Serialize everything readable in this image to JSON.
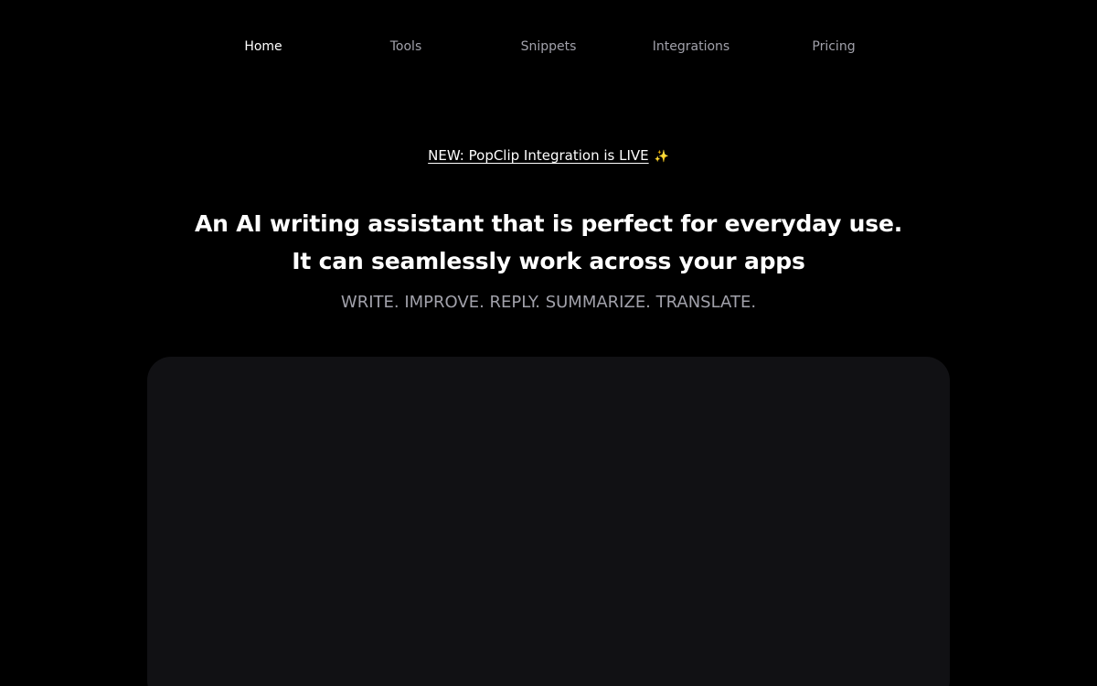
{
  "nav": {
    "items": [
      {
        "label": "Home",
        "active": true
      },
      {
        "label": "Tools",
        "active": false
      },
      {
        "label": "Snippets",
        "active": false
      },
      {
        "label": "Integrations",
        "active": false
      },
      {
        "label": "Pricing",
        "active": false
      }
    ]
  },
  "announcement": {
    "text": "NEW: PopClip Integration is LIVE",
    "icon": "sparkles-icon",
    "emoji": "✨"
  },
  "hero": {
    "headline": "An AI writing assistant that is perfect for everyday use. It can seamlessly work across your apps",
    "tagline": "WRITE. IMPROVE. REPLY. SUMMARIZE. TRANSLATE."
  },
  "colors": {
    "background": "#000000",
    "nav_active": "#ffffff",
    "nav_inactive": "#a1a1aa",
    "panel": "#111114"
  }
}
